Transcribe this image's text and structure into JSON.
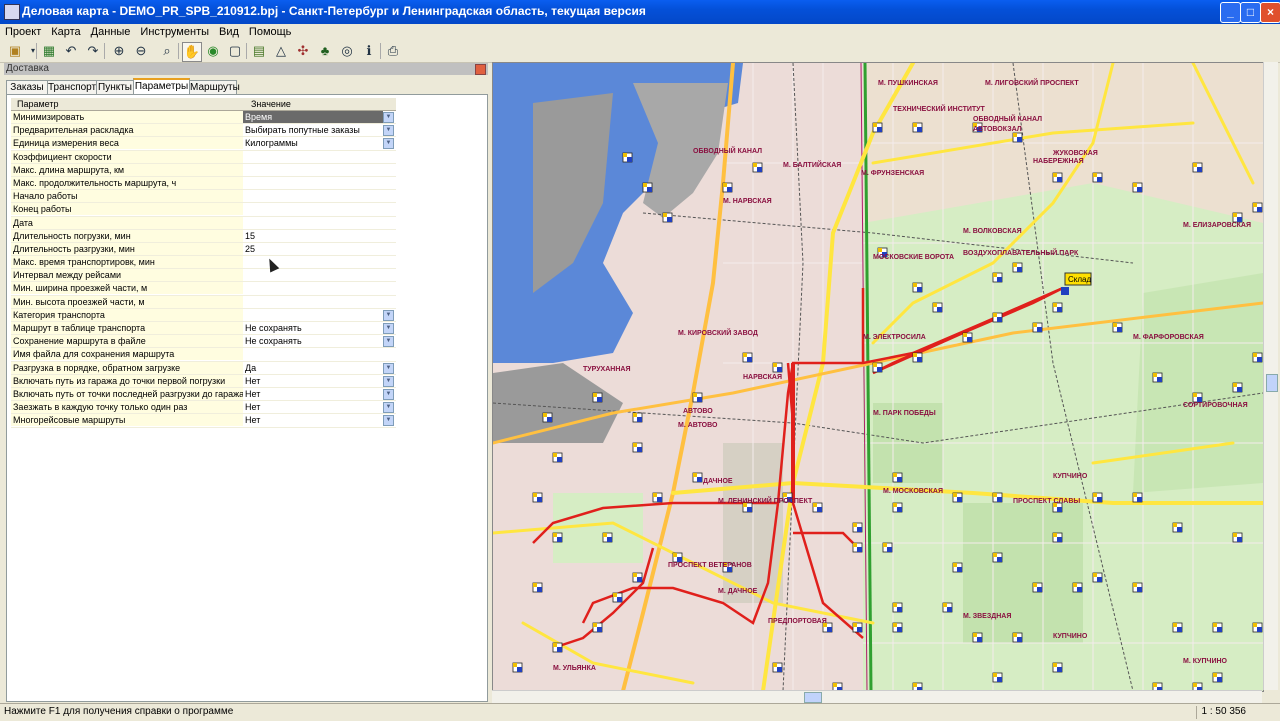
{
  "window": {
    "title": "Деловая карта - DEMO_PR_SPB_210912.bpj - Санкт-Петербург и Ленинградская область, текущая версия"
  },
  "menu": [
    "Проект",
    "Карта",
    "Данные",
    "Инструменты",
    "Вид",
    "Помощь"
  ],
  "panel": {
    "title": "Доставка",
    "tabs": [
      "Заказы",
      "Транспорт",
      "Пункты",
      "Параметры",
      "Маршруты"
    ],
    "active_tab": "Параметры",
    "columns": [
      "Параметр",
      "Значение"
    ],
    "rows": [
      {
        "param": "Минимизировать",
        "value": "Время",
        "dropdown": true,
        "selected": true
      },
      {
        "param": "Предварительная раскладка",
        "value": "Выбирать попутные заказы",
        "dropdown": true
      },
      {
        "param": "Единица измерения веса",
        "value": "Килограммы",
        "dropdown": true
      },
      {
        "param": "Коэффициент скорости",
        "value": ""
      },
      {
        "param": "Макс. длина маршрута, км",
        "value": ""
      },
      {
        "param": "Макс. продолжительность маршрута, ч",
        "value": ""
      },
      {
        "param": "Начало работы",
        "value": ""
      },
      {
        "param": "Конец работы",
        "value": ""
      },
      {
        "param": "Дата",
        "value": ""
      },
      {
        "param": "Длительность погрузки, мин",
        "value": "15"
      },
      {
        "param": "Длительность разгрузки, мин",
        "value": "25"
      },
      {
        "param": "Макс. время транспортировк, мин",
        "value": ""
      },
      {
        "param": "Интервал между рейсами",
        "value": ""
      },
      {
        "param": "Мин. ширина проезжей части, м",
        "value": ""
      },
      {
        "param": "Мин. высота проезжей части, м",
        "value": ""
      },
      {
        "param": "Категория транспорта",
        "value": "",
        "dropdown": true
      },
      {
        "param": "Маршрут в таблице транспорта",
        "value": "Не сохранять",
        "dropdown": true
      },
      {
        "param": "Сохранение маршрута в файле",
        "value": "Не сохранять",
        "dropdown": true
      },
      {
        "param": "Имя файла для сохранения маршрута",
        "value": ""
      },
      {
        "param": "Разгрузка в порядке, обратном загрузке",
        "value": "Да",
        "dropdown": true
      },
      {
        "param": "Включать путь из гаража до точки первой погрузки",
        "value": "Нет",
        "dropdown": true
      },
      {
        "param": "Включать путь от точки последней разгрузки до гаража",
        "value": "Нет",
        "dropdown": true
      },
      {
        "param": "Заезжать в каждую точку только один раз",
        "value": "Нет",
        "dropdown": true
      },
      {
        "param": "Многорейсовые маршруты",
        "value": "Нет",
        "dropdown": true
      }
    ]
  },
  "map_labels": [
    "М. ПУШКИНСКАЯ",
    "М. ЛИГОВСКИЙ ПРОСПЕКТ",
    "ТЕХНИЧЕСКИЙ ИНСТИТУТ",
    "ОБВОДНЫЙ КАНАЛ",
    "АВТОВОКЗАЛ",
    "М. ФРУНЗЕНСКАЯ",
    "ЖУКОВСКАЯ",
    "НАБЕРЕЖНАЯ",
    "ОБВОДНЫЙ КАНАЛ",
    "М. БАЛТИЙСКАЯ",
    "М. НАРВСКАЯ",
    "М. ВОЛКОВСКАЯ",
    "М. ЕЛИЗАРОВСКАЯ",
    "МОСКОВСКИЕ ВОРОТА",
    "ВОЗДУХОПЛАВАТЕЛЬНЫЙ ПАРК",
    "Склад",
    "М. ЭЛЕКТРОСИЛА",
    "М. ФАРФОРОВСКАЯ",
    "М. КИРОВСКИЙ ЗАВОД",
    "ТУРУХАННАЯ",
    "НАРВСКАЯ",
    "М. ПАРК ПОБЕДЫ",
    "СОРТИРОВОЧНАЯ",
    "АВТОВО",
    "М. АВТОВО",
    "ДАЧНОЕ",
    "М. ЛЕНИНСКИЙ ПРОСПЕКТ",
    "М. МОСКОВСКАЯ",
    "КУПЧИНО",
    "ПРОСПЕКТ СЛАВЫ",
    "ПРОСПЕКТ ВЕТЕРАНОВ",
    "М. ДАЧНОЕ",
    "М. ЗВЕЗДНАЯ",
    "КУПЧИНО",
    "ПРЕДПОРТОВАЯ",
    "М. УЛЬЯНКА",
    "М. КУПЧИНО"
  ],
  "status": {
    "hint": "Нажмите F1 для получения справки о программе",
    "scale": "1 : 50 356"
  },
  "colors": {
    "route": "#e0201c",
    "water": "#5b88d8",
    "park": "#d6edc4",
    "road_major": "#ffe640",
    "road_main": "#ffc040",
    "rail": "#30a030",
    "metro": "#b01a6a"
  }
}
